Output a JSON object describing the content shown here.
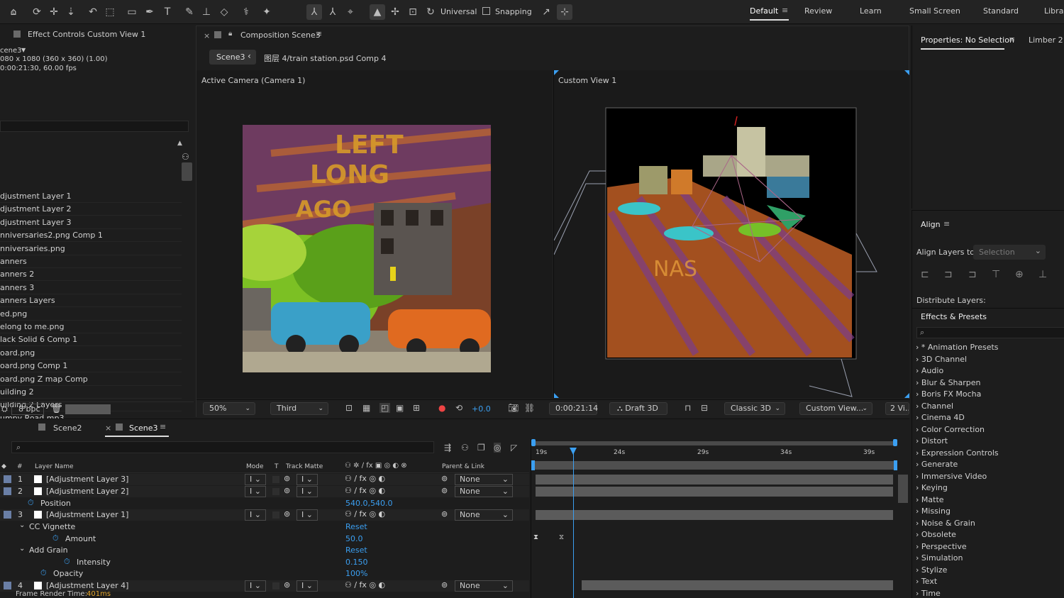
{
  "toolbar": {
    "universal_label": "Universal",
    "snapping_label": "Snapping",
    "workspaces": [
      "Default",
      "Review",
      "Learn",
      "Small Screen",
      "Standard",
      "Librar"
    ]
  },
  "effect_controls": {
    "tab_title": "Effect Controls Custom View 1"
  },
  "project": {
    "item_name": "cene3",
    "item_size": "080 x 1080  (360 x 360) (1.00)",
    "item_duration": "0:00:21:30, 60.00 fps",
    "items": [
      "djustment Layer 1",
      "djustment Layer 2",
      "djustment Layer 3",
      "nniversaries2.png Comp 1",
      "nniversaries.png",
      "anners",
      "anners 2",
      "anners 3",
      "anners Layers",
      "ed.png",
      "elong to me.png",
      "lack Solid 6 Comp 1",
      "oard.png",
      "oard.png Comp 1",
      "oard.png Z map Comp",
      "uilding 2",
      "uilding 2 Layers",
      "umpy Road.mp3"
    ],
    "bpc": "8 bpc"
  },
  "composition": {
    "tab_title": "Composition Scene3",
    "breadcrumb_scene": "Scene3",
    "breadcrumb_path": "图层 4/train station.psd Comp 4",
    "left_view_label": "Active Camera (Camera 1)",
    "right_view_label": "Custom View 1",
    "zoom": "50%",
    "resolution": "Third",
    "exposure": "+0.0",
    "timecode": "0:00:21:14",
    "draft_label": "Draft 3D",
    "renderer": "Classic 3D",
    "view_select": "Custom View...",
    "views_count": "2 Vi..."
  },
  "properties": {
    "tab_title": "Properties: No Selection",
    "other_tab": "Limber 2"
  },
  "align": {
    "title": "Align",
    "align_layers_to_label": "Align Layers to:",
    "align_layers_to_value": "Selection",
    "distribute_label": "Distribute Layers:"
  },
  "effects_presets": {
    "title": "Effects & Presets",
    "categories": [
      "* Animation Presets",
      "3D Channel",
      "Audio",
      "Blur & Sharpen",
      "Boris FX Mocha",
      "Channel",
      "Cinema 4D",
      "Color Correction",
      "Distort",
      "Expression Controls",
      "Generate",
      "Immersive Video",
      "Keying",
      "Matte",
      "Missing",
      "Noise & Grain",
      "Obsolete",
      "Perspective",
      "Simulation",
      "Stylize",
      "Text",
      "Time"
    ]
  },
  "timeline": {
    "tabs": [
      "Scene2",
      "Scene3"
    ],
    "headers": {
      "hash": "#",
      "layer_name": "Layer Name",
      "mode": "Mode",
      "t": "T",
      "track_matte": "Track Matte",
      "parent": "Parent & Link"
    },
    "ruler": [
      "19s",
      "24s",
      "29s",
      "34s",
      "39s"
    ],
    "layers": [
      {
        "num": "1",
        "name": "[Adjustment Layer 3]",
        "parent": "None"
      },
      {
        "num": "2",
        "name": "[Adjustment Layer 2]",
        "parent": "None"
      },
      {
        "num": "3",
        "name": "[Adjustment Layer 1]",
        "parent": "None"
      },
      {
        "num": "4",
        "name": "[Adjustment Layer 4]",
        "parent": "None"
      }
    ],
    "props": {
      "position_label": "Position",
      "position_value": "540.0,540.0",
      "vignette_label": "CC Vignette",
      "vignette_reset": "Reset",
      "amount_label": "Amount",
      "amount_value": "50.0",
      "grain_label": "Add Grain",
      "grain_reset": "Reset",
      "intensity_label": "Intensity",
      "intensity_value": "0.150",
      "opacity_label": "Opacity",
      "opacity_value": "100%"
    },
    "render_time_label": "Frame Render Time:",
    "render_time_value": "401ms"
  }
}
